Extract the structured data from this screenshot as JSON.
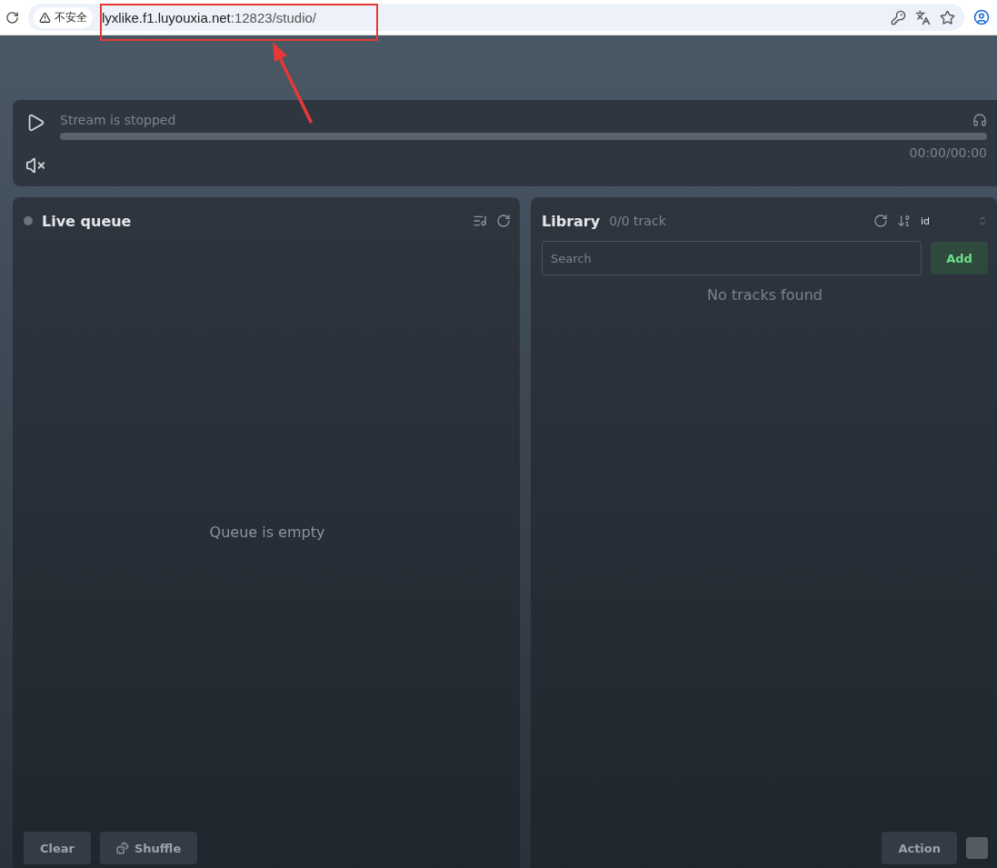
{
  "browser": {
    "security": "不安全",
    "url_host": "lyxlike.f1.luyouxia.net",
    "url_rest": ":12823/studio/"
  },
  "player": {
    "status": "Stream is stopped",
    "time": "00:00/00:00",
    "muted": true
  },
  "queue": {
    "title": "Live queue",
    "empty": "Queue is empty",
    "buttons": [
      "Clear",
      "Shuffle"
    ]
  },
  "library": {
    "title": "Library",
    "count": "0/0 track",
    "sort": "id",
    "search": {
      "placeholder": "Search"
    },
    "add": "Add",
    "empty": "No tracks found",
    "action": "Action",
    "checked": false
  }
}
